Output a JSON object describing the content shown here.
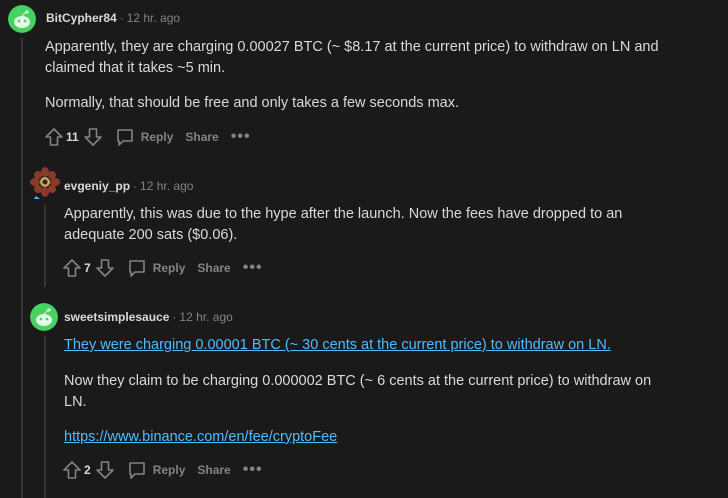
{
  "comments": [
    {
      "author": "BitCypher84",
      "time": "12 hr. ago",
      "paragraphs": [
        "Apparently, they are charging 0.00027 BTC (~ $8.17 at the current price) to withdraw on LN and claimed that it takes ~5 min.",
        "Normally, that should be free and only takes a few seconds max."
      ],
      "score": "11",
      "reply_label": "Reply",
      "share_label": "Share",
      "more_label": "•••"
    },
    {
      "author": "evgeniy_pp",
      "time": "12 hr. ago",
      "paragraphs": [
        "Apparently, this was due to the hype after the launch. Now the fees have dropped to an adequate 200 sats ($0.06)."
      ],
      "score": "7",
      "reply_label": "Reply",
      "share_label": "Share",
      "more_label": "•••"
    },
    {
      "author": "sweetsimplesauce",
      "time": "12 hr. ago",
      "link_text": "They were charging 0.00001 BTC (~ 30 cents at the current price) to withdraw on LN.",
      "paragraph": "Now they claim to be charging 0.000002 BTC (~ 6 cents at the current price) to withdraw on LN.",
      "url_text": "https://www.binance.com/en/fee/cryptoFee",
      "score": "2",
      "reply_label": "Reply",
      "share_label": "Share",
      "more_label": "•••"
    }
  ],
  "colors": {
    "background": "#1a1a1b",
    "text": "#d7dadc",
    "muted": "#818384",
    "link": "#4fbcff",
    "avatar_green": "#46d160"
  }
}
